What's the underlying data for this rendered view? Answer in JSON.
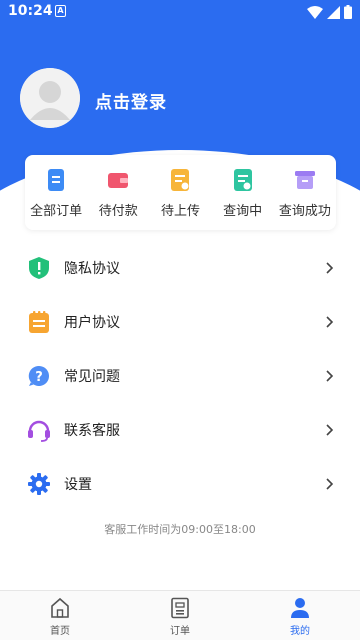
{
  "status": {
    "time": "10:24",
    "notif_letter": "A"
  },
  "profile": {
    "login_label": "点击登录"
  },
  "orders": [
    {
      "label": "全部订单",
      "icon": "all-orders-icon"
    },
    {
      "label": "待付款",
      "icon": "wallet-icon"
    },
    {
      "label": "待上传",
      "icon": "upload-doc-icon"
    },
    {
      "label": "查询中",
      "icon": "searching-doc-icon"
    },
    {
      "label": "查询成功",
      "icon": "archive-box-icon"
    }
  ],
  "menu": [
    {
      "label": "隐私协议",
      "icon": "shield-icon"
    },
    {
      "label": "用户协议",
      "icon": "notepad-icon"
    },
    {
      "label": "常见问题",
      "icon": "help-circle-icon"
    },
    {
      "label": "联系客服",
      "icon": "headset-icon"
    },
    {
      "label": "设置",
      "icon": "gear-icon"
    }
  ],
  "service_hours": "客服工作时间为09:00至18:00",
  "tabbar": [
    {
      "label": "首页",
      "icon": "home-icon"
    },
    {
      "label": "订单",
      "icon": "order-icon"
    },
    {
      "label": "我的",
      "icon": "user-icon",
      "active": true
    }
  ],
  "colors": {
    "brand": "#2b6cf0"
  }
}
